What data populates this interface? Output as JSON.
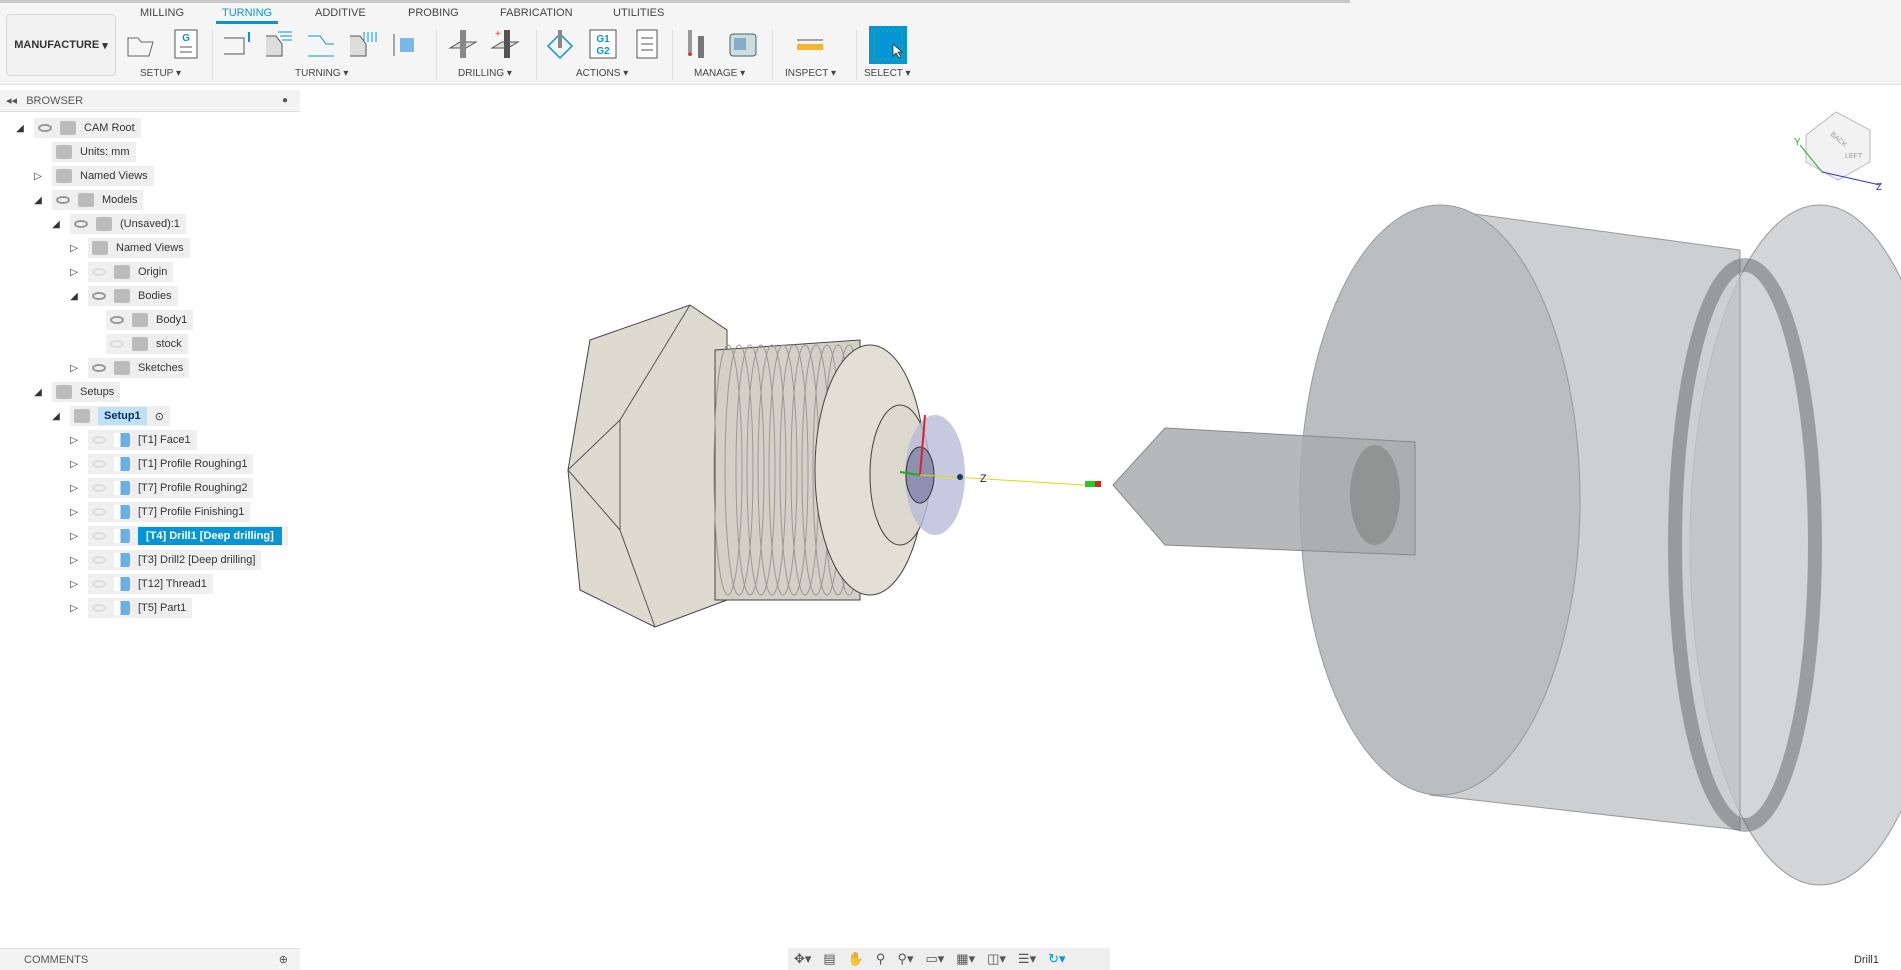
{
  "toolbar": {
    "workspace": "MANUFACTURE",
    "tabs": [
      "MILLING",
      "TURNING",
      "ADDITIVE",
      "PROBING",
      "FABRICATION",
      "UTILITIES"
    ],
    "active_tab": "TURNING",
    "groups": [
      "SETUP",
      "TURNING",
      "DRILLING",
      "ACTIONS",
      "MANAGE",
      "INSPECT",
      "SELECT"
    ],
    "accent": "#0696d7"
  },
  "browser": {
    "title": "BROWSER",
    "items": [
      {
        "label": "CAM Root",
        "icon": "component-icon"
      },
      {
        "label": "Units: mm",
        "icon": "units-icon"
      },
      {
        "label": "Named Views",
        "icon": "folder-icon"
      },
      {
        "label": "Models",
        "icon": "component-icon"
      },
      {
        "label": "(Unsaved):1",
        "icon": "body-icon"
      },
      {
        "label": "Named Views",
        "icon": "folder-icon"
      },
      {
        "label": "Origin",
        "icon": "folder-icon"
      },
      {
        "label": "Bodies",
        "icon": "folder-icon"
      },
      {
        "label": "Body1",
        "icon": "body-icon"
      },
      {
        "label": "stock",
        "icon": "body-icon"
      },
      {
        "label": "Sketches",
        "icon": "folder-icon"
      },
      {
        "label": "Setups",
        "icon": "setup-icon"
      },
      {
        "label": "Setup1",
        "icon": "setup-icon"
      },
      {
        "label": "[T1] Face1",
        "icon": "face-icon"
      },
      {
        "label": "[T1] Profile Roughing1",
        "icon": "roughing-icon"
      },
      {
        "label": "[T7] Profile Roughing2",
        "icon": "roughing-icon"
      },
      {
        "label": "[T7] Profile Finishing1",
        "icon": "finishing-icon"
      },
      {
        "label": "[T4] Drill1 [Deep drilling]",
        "icon": "drill-icon"
      },
      {
        "label": "[T3] Drill2 [Deep drilling]",
        "icon": "drill-icon"
      },
      {
        "label": "[T12] Thread1",
        "icon": "thread-icon"
      },
      {
        "label": "[T5] Part1",
        "icon": "part-icon"
      }
    ],
    "selected": "[T4] Drill1 [Deep drilling]"
  },
  "viewport": {
    "axis_label": "Z",
    "viewcube_faces": [
      "BACK",
      "LEFT"
    ],
    "viewcube_axes": [
      "Y",
      "Z"
    ]
  },
  "bottom": {
    "comments": "COMMENTS",
    "status": "Drill1"
  }
}
